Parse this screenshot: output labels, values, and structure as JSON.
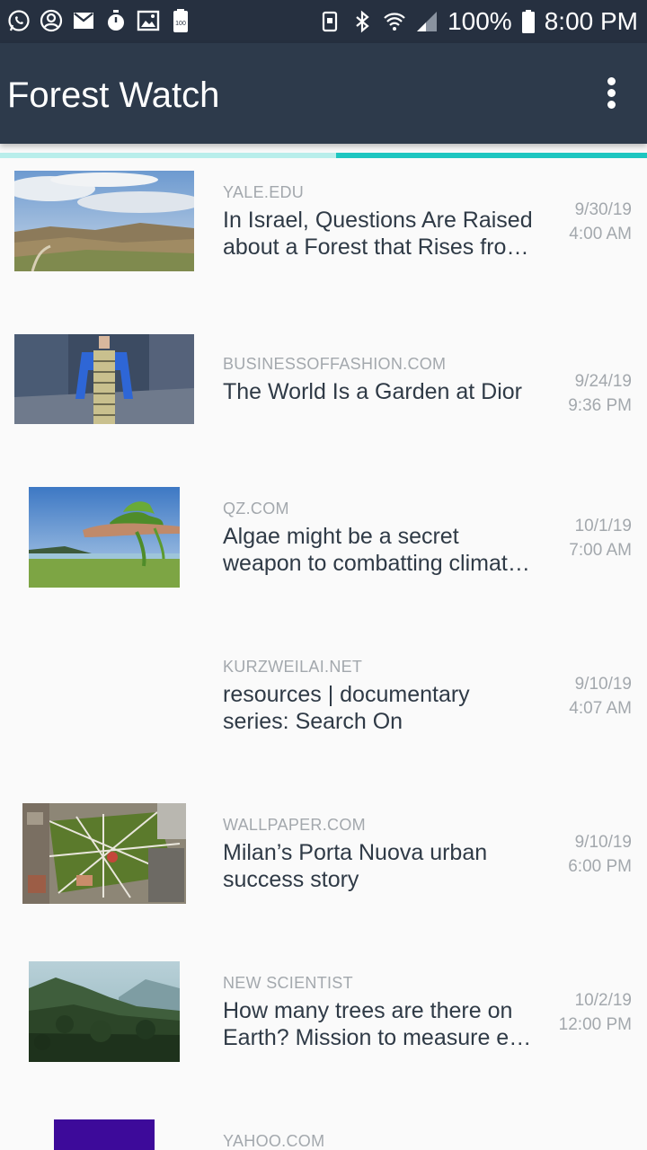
{
  "status_bar": {
    "left_icons": [
      "whatsapp-icon",
      "account-circle-icon",
      "mail-icon",
      "timer-icon",
      "image-icon",
      "battery-saver-100-icon"
    ],
    "right_icons": [
      "nfc-icon",
      "bluetooth-icon",
      "wifi-icon",
      "signal-icon"
    ],
    "battery_percent": "100%",
    "time": "8:00 PM"
  },
  "app_bar": {
    "title": "Forest Watch",
    "menu_icon": "more-vert-icon"
  },
  "loading_progress": 0.48,
  "colors": {
    "status_bar": "#263040",
    "app_bar": "#2d3a4b",
    "progress_track": "#b9eeeb",
    "progress_fill": "#1ec6c0",
    "source_text": "#a3a8ad",
    "headline_text": "#2f3a46",
    "background": "#fafafa"
  },
  "articles": [
    {
      "source": "YALE.EDU",
      "headline_line1": "In Israel, Questions Are Raised",
      "headline_line2": "about a Forest that Rises from the Desert",
      "date": "9/30/19",
      "time": "4:00 AM",
      "image": "desert-forest-landscape"
    },
    {
      "source": "BUSINESSOFFASHION.COM",
      "headline_line1": "The World Is a Garden at Dior",
      "headline_line2": "",
      "date": "9/24/19",
      "time": "9:36 PM",
      "image": "fashion-model-apron"
    },
    {
      "source": "QZ.COM",
      "headline_line1": "Algae might be a secret",
      "headline_line2": "weapon to combatting climate change",
      "date": "10/1/19",
      "time": "7:00 AM",
      "image": "hand-holding-algae"
    },
    {
      "source": "KURZWEILAI.NET",
      "headline_line1": "resources | documentary",
      "headline_line2": "series: Search On",
      "date": "9/10/19",
      "time": "4:07 AM",
      "image": ""
    },
    {
      "source": "WALLPAPER.COM",
      "headline_line1": "Milan’s Porta Nuova urban",
      "headline_line2": "success story",
      "date": "9/10/19",
      "time": "6:00 PM",
      "image": "aerial-park-city"
    },
    {
      "source": "NEW SCIENTIST",
      "headline_line1": "How many trees are there on",
      "headline_line2": "Earth? Mission to measure every tree",
      "date": "10/2/19",
      "time": "12:00 PM",
      "image": "forest-mountains"
    },
    {
      "source": "YAHOO.COM",
      "headline_line1": "",
      "headline_line2": "",
      "date": "",
      "time": "",
      "image": "purple-square"
    }
  ]
}
